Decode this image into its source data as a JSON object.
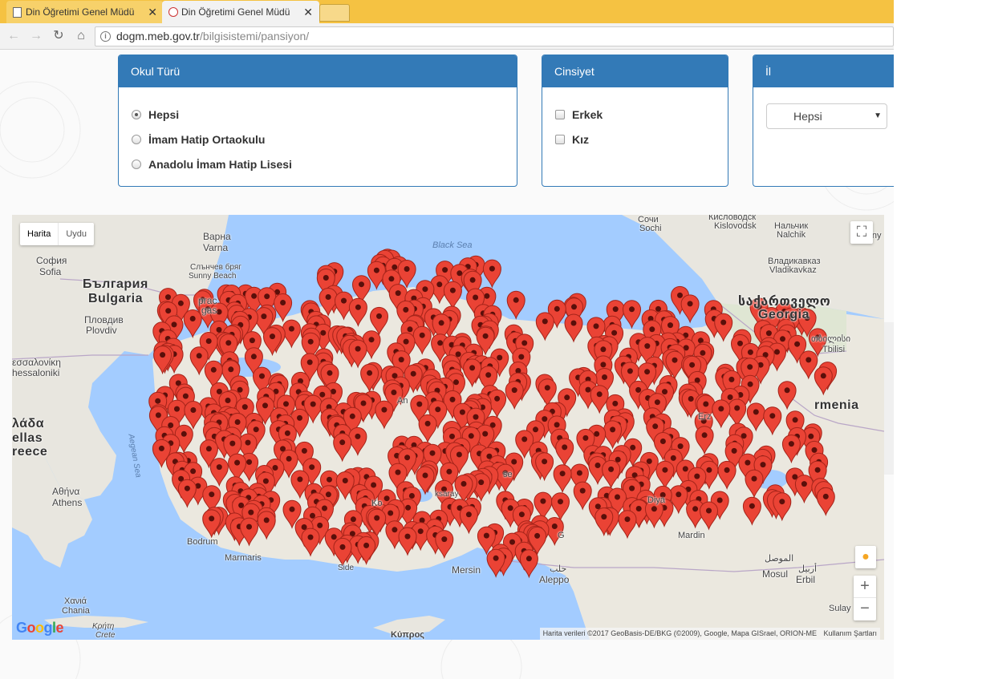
{
  "browser": {
    "tabs": [
      {
        "title": "Din Öğretimi Genel Müdü",
        "active": false
      },
      {
        "title": "Din Öğretimi Genel Müdü",
        "active": true
      }
    ],
    "url_host": "dogm.meb.gov.tr",
    "url_path": "/bilgisistemi/pansiyon/"
  },
  "filters": {
    "school_type": {
      "title": "Okul Türü",
      "options": [
        {
          "label": "Hepsi",
          "selected": true
        },
        {
          "label": "İmam Hatip Ortaokulu",
          "selected": false
        },
        {
          "label": "Anadolu İmam Hatip Lisesi",
          "selected": false
        }
      ]
    },
    "gender": {
      "title": "Cinsiyet",
      "options": [
        {
          "label": "Erkek",
          "checked": false
        },
        {
          "label": "Kız",
          "checked": false
        }
      ]
    },
    "province": {
      "title": "İl",
      "selected": "Hepsi"
    }
  },
  "map": {
    "type_buttons": [
      "Harita",
      "Uydu"
    ],
    "google": "Google",
    "attribution": "Harita verileri ©2017 GeoBasis-DE/BKG (©2009), Google, Mapa GISrael, ORION-ME",
    "terms": "Kullanım Şartları",
    "labels": {
      "black_sea": "Black Sea",
      "aegean": "Aegean Sea",
      "bulgaria_bg": "България",
      "bulgaria": "Bulgaria",
      "georgia_ka": "საქართველო",
      "georgia": "Georgia",
      "armenia": "rmenia",
      "greece_el": "λάδα",
      "greece_1": "ellas",
      "greece_2": "reece",
      "sofia_bg": "София",
      "sofia": "Sofia",
      "varna_bg": "Варна",
      "varna": "Varna",
      "sunny_bg": "Слънчев бряг",
      "sunny": "Sunny Beach",
      "burgas_1": "ргас",
      "burgas_2": "gas",
      "plovdiv_bg": "Пловдив",
      "plovdiv": "Plovdiv",
      "thess_el": "εσσαλονίκη",
      "thess": "hessaloniki",
      "athens_el": "Αθήνα",
      "athens": "Athens",
      "chania_el": "Χανιά",
      "chania": "Chania",
      "crete_el": "Κρήτη",
      "crete": "Crete",
      "sochi_ru": "Сочи",
      "sochi": "Sochi",
      "kislo_ru": "Кисловодск",
      "kislo": "Kislovodsk",
      "nalchik_ru": "Нальчик",
      "nalchik": "Nalchik",
      "vladi_ru": "Владикавказ",
      "vladi": "Vladikavkaz",
      "grozny_1": "Гр",
      "grozny_2": "Grozny",
      "tbilisi_ka": "თბილისი",
      "tbilisi": "Tbilisi",
      "mersin": "Mersin",
      "aleppo_ar": "حلب",
      "aleppo": "Aleppo",
      "mosul_ar": "الموصل",
      "mosul": "Mosul",
      "erbil_ar": "أربيل",
      "erbil": "Erbil",
      "sulay": "Sulay",
      "kypros": "Κύπρος",
      "bodrum": "Bodrum",
      "marmaris": "Marmaris",
      "side": "Side",
      "erz": "Erz",
      "diya": "Diya",
      "kon": "Ko",
      "aksaray": "ksaray",
      "kayseri": "se",
      "gaz": "G",
      "mardin": "Mardin",
      "an": "An"
    }
  }
}
